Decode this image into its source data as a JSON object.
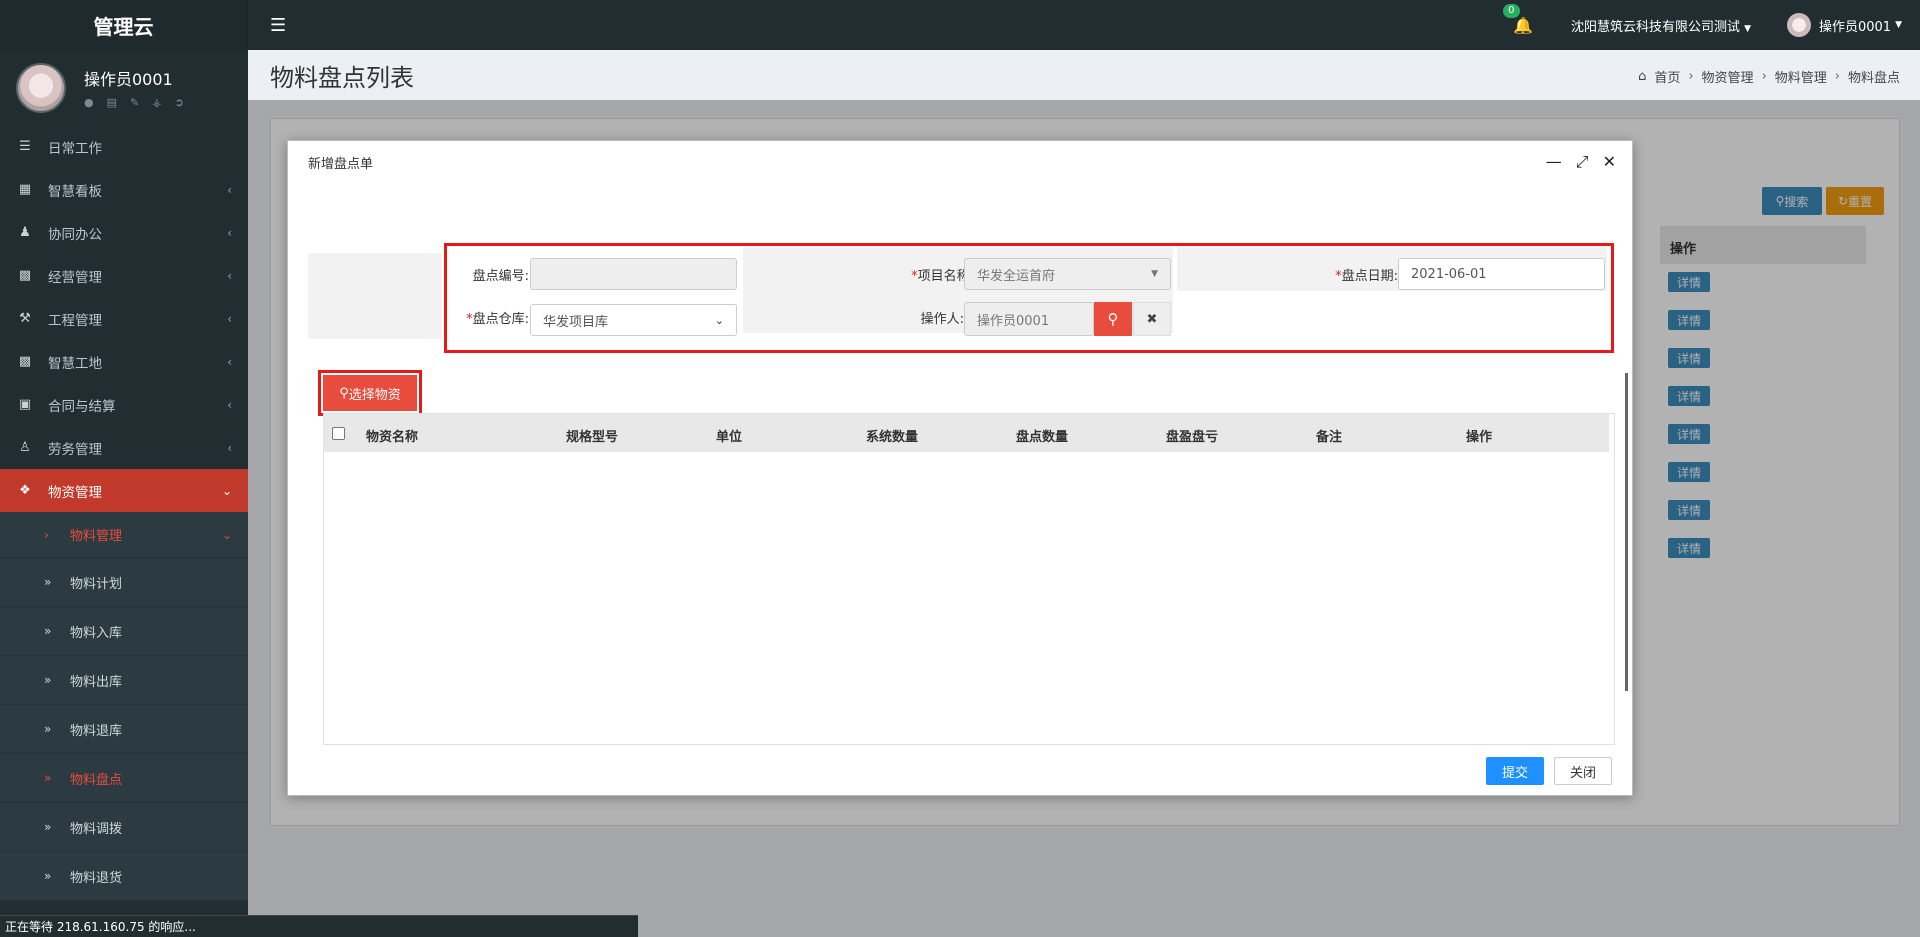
{
  "brand": "管理云",
  "user": {
    "name": "操作员0001"
  },
  "menu": [
    {
      "label": "日常工作",
      "icon": "list-icon"
    },
    {
      "label": "智慧看板",
      "icon": "dashboard-icon"
    },
    {
      "label": "协同办公",
      "icon": "users-icon"
    },
    {
      "label": "经营管理",
      "icon": "monitor-icon"
    },
    {
      "label": "工程管理",
      "icon": "hammer-icon"
    },
    {
      "label": "智慧工地",
      "icon": "monitor-icon"
    },
    {
      "label": "合同与结算",
      "icon": "file-icon"
    },
    {
      "label": "劳务管理",
      "icon": "worker-icon"
    },
    {
      "label": "物资管理",
      "icon": "cube-icon"
    }
  ],
  "submenu": {
    "group": "物料管理",
    "items": [
      "物料计划",
      "物料入库",
      "物料出库",
      "物料退库",
      "物料盘点",
      "物料调拨",
      "物料退货"
    ]
  },
  "topbar": {
    "notification_count": "0",
    "company": "沈阳慧筑云科技有限公司测试",
    "operator": "操作员0001"
  },
  "page": {
    "title": "物料盘点列表",
    "breadcrumb": [
      "首页",
      "物资管理",
      "物料管理",
      "物料盘点"
    ]
  },
  "background": {
    "search_label": "搜索",
    "reset_label": "重置",
    "op_header": "操作",
    "detail_label": "详情"
  },
  "modal": {
    "title": "新增盘点单",
    "fields": {
      "code_label": "盘点编号:",
      "code_value": "",
      "project_label": "项目名称:",
      "project_value": "华发全运首府",
      "date_label": "盘点日期:",
      "date_value": "2021-06-01",
      "warehouse_label": "盘点仓库:",
      "warehouse_value": "华发项目库",
      "operator_label": "操作人:",
      "operator_value": "操作员0001"
    },
    "select_button": "选择物资",
    "columns": [
      "物资名称",
      "规格型号",
      "单位",
      "系统数量",
      "盘点数量",
      "盘盈盘亏",
      "备注",
      "操作"
    ],
    "submit_label": "提交",
    "close_label": "关闭"
  },
  "status_bar": "正在等待 218.61.160.75 的响应..."
}
